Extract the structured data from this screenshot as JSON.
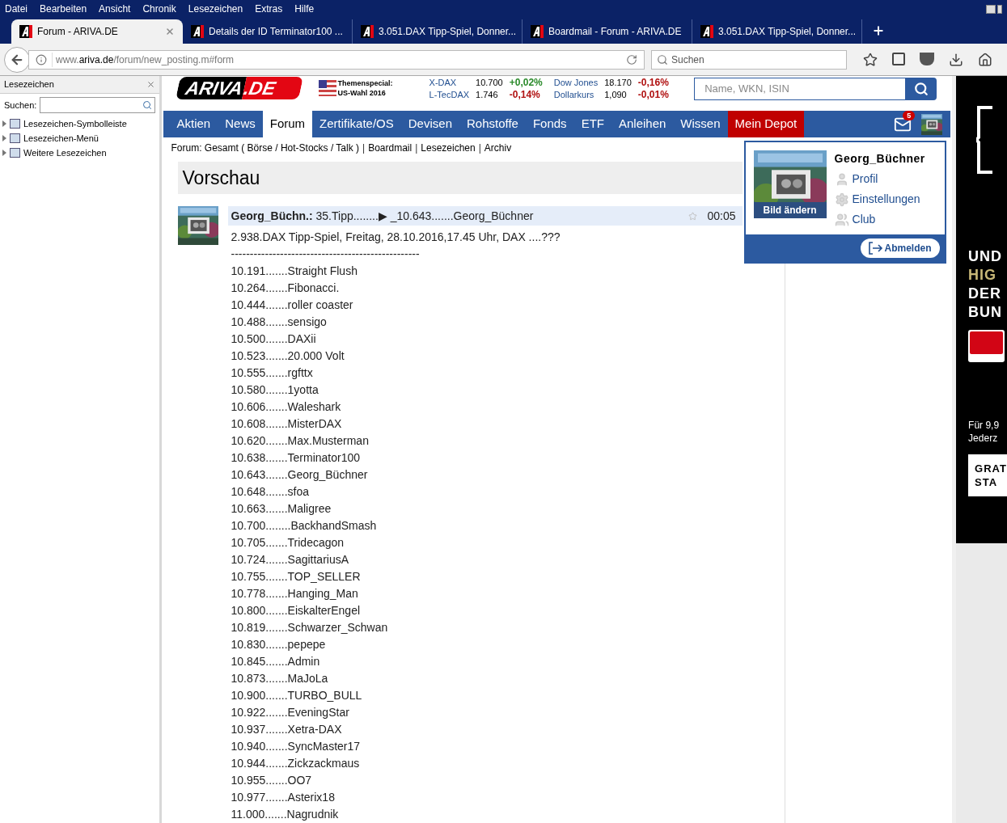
{
  "menu": [
    "Datei",
    "Bearbeiten",
    "Ansicht",
    "Chronik",
    "Lesezeichen",
    "Extras",
    "Hilfe"
  ],
  "tabs": [
    {
      "title": "Forum - ARIVA.DE",
      "selected": true
    },
    {
      "title": "Details der ID Terminator100 ...",
      "selected": false
    },
    {
      "title": "3.051.DAX Tipp-Spiel, Donner...",
      "selected": false
    },
    {
      "title": "Boardmail - Forum - ARIVA.DE",
      "selected": false
    },
    {
      "title": "3.051.DAX Tipp-Spiel, Donner...",
      "selected": false
    }
  ],
  "address": {
    "prefix": "www.",
    "domain": "ariva.de",
    "path": "/forum/new_posting.m#form"
  },
  "browser_search": {
    "placeholder": "Suchen"
  },
  "sidebar": {
    "title": "Lesezeichen",
    "search_label": "Suchen:",
    "items": [
      {
        "label": "Lesezeichen-Symbolleiste",
        "expanded": false
      },
      {
        "label": "Lesezeichen-Menü",
        "expanded": false
      },
      {
        "label": "Weitere Lesezeichen",
        "expanded": false
      }
    ]
  },
  "site": {
    "logo": "ARIVA",
    "logo_suffix": ".DE",
    "special_title": "Themenspecial:",
    "special_sub": "US-Wahl 2016",
    "tickers": [
      {
        "name": "X-DAX",
        "value": "10.700",
        "change": "+0,02%",
        "color": "#2a8a2a"
      },
      {
        "name": "Dow Jones",
        "value": "18.170",
        "change": "-0,16%",
        "color": "#b01010"
      },
      {
        "name": "L-TecDAX",
        "value": "1.746",
        "change": "-0,14%",
        "color": "#b01010"
      },
      {
        "name": "Dollarkurs",
        "value": "1,090",
        "change": "-0,01%",
        "color": "#b01010"
      }
    ],
    "search_placeholder": "Name, WKN, ISIN"
  },
  "nav": [
    {
      "label": "Aktien",
      "selected": false,
      "kind": "standard"
    },
    {
      "label": "News",
      "selected": false,
      "kind": "standard"
    },
    {
      "label": "Forum",
      "selected": true,
      "kind": "standard"
    },
    {
      "label": "Zertifikate/OS",
      "selected": false,
      "kind": "standard"
    },
    {
      "label": "Devisen",
      "selected": false,
      "kind": "standard"
    },
    {
      "label": "Rohstoffe",
      "selected": false,
      "kind": "standard"
    },
    {
      "label": "Fonds",
      "selected": false,
      "kind": "standard"
    },
    {
      "label": "ETF",
      "selected": false,
      "kind": "standard"
    },
    {
      "label": "Anleihen",
      "selected": false,
      "kind": "standard"
    },
    {
      "label": "Wissen",
      "selected": false,
      "kind": "standard"
    },
    {
      "label": "Mein Depot",
      "selected": false,
      "kind": "depot"
    }
  ],
  "mail_badge": "5",
  "breadcrumb": [
    {
      "label": "Forum: Gesamt ( Börse / Hot-Stocks / Talk )"
    },
    {
      "separator": "|",
      "label": "Boardmail"
    },
    {
      "separator": "|",
      "label": "Lesezeichen"
    },
    {
      "separator": "|",
      "label": "Archiv"
    }
  ],
  "user_menu": {
    "username": "Georg_Büchner",
    "change_picture": "Bild ändern",
    "links": [
      {
        "label": "Profil",
        "kind": "profile"
      },
      {
        "label": "Einstellungen",
        "kind": "settings"
      },
      {
        "label": "Club",
        "kind": "club"
      }
    ],
    "logout": "Abmelden"
  },
  "preview_title": "Vorschau",
  "post": {
    "author": "Georg_Büchn.:",
    "subject": "35.Tipp........▶ _10.643.......Georg_Büchner",
    "starred": false,
    "time": "00:05",
    "headline": "2.938.DAX Tipp-Spiel, Freitag, 28.10.2016,17.45 Uhr, DAX ....???",
    "separator": "--------------------------------------------------",
    "lines": [
      "10.191.......Straight Flush",
      "10.264.......Fibonacci.",
      "10.444.......roller coaster",
      "10.488.......sensigo",
      "10.500.......DAXii",
      "10.523.......20.000 Volt",
      "10.555.......rgfttx",
      "10.580.......1yotta",
      "10.606.......Waleshark",
      "10.608.......MisterDAX",
      "10.620.......Max.Musterman",
      "10.638.......Terminator100",
      "10.643.......Georg_Büchner",
      "10.648.......sfoa",
      "10.663.......Maligree",
      "10.700........BackhandSmash",
      "10.705.......Tridecagon",
      "10.724.......SagittariusA",
      "10.755.......TOP_SELLER",
      "10.778.......Hanging_Man",
      "10.800.......EiskalterEngel",
      "10.819.......Schwarzer_Schwan",
      "10.830.......pepepe",
      "10.845.......Admin",
      "10.873.......MaJoLa",
      "10.900.......TURBO_BULL",
      "10.922.......EveningStar",
      "10.937.......Xetra-DAX",
      "10.940.......SyncMaster17",
      "10.944.......Zickzackmaus",
      "10.955.......OO7",
      "10.977.......Asterix18",
      "11.000.......Nagrudnik"
    ]
  },
  "ad": {
    "headline": [
      {
        "text": "UND",
        "highlighted": false
      },
      {
        "text": "HIG",
        "highlighted": true
      },
      {
        "text": "DER",
        "highlighted": false
      },
      {
        "text": "BUN",
        "highlighted": false
      }
    ],
    "price": [
      "Für 9,9",
      "Jederz"
    ],
    "cta": [
      "GRAT",
      "STA"
    ]
  }
}
